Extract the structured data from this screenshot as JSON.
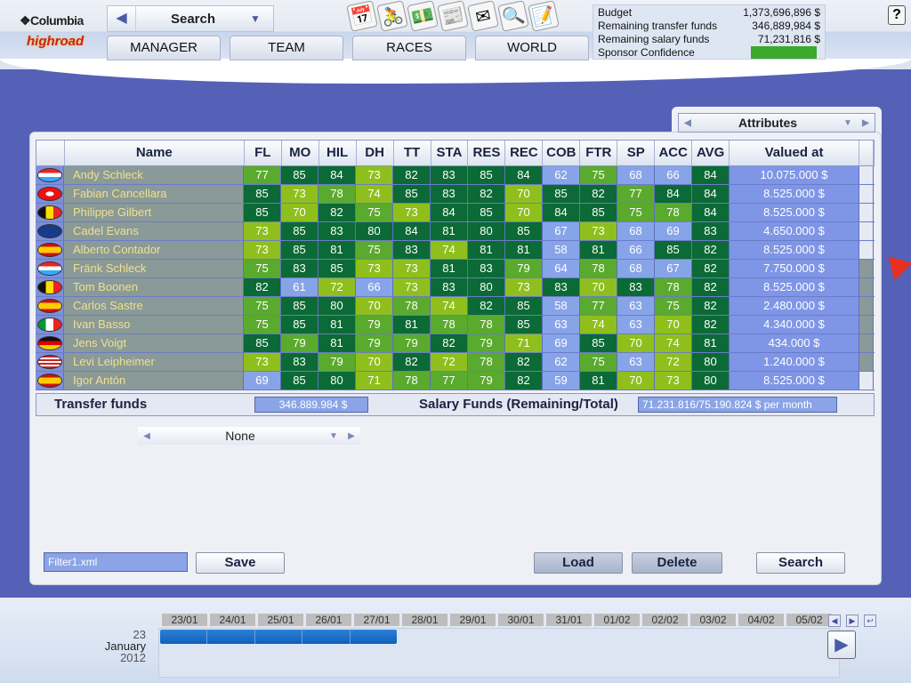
{
  "brand": {
    "logo_top": "❖Columbia",
    "logo_bottom": "highroad"
  },
  "search_select": {
    "value": "Search"
  },
  "tabs": [
    "MANAGER",
    "TEAM",
    "RACES",
    "WORLD"
  ],
  "toolbar_icons": [
    "calendar-icon",
    "rider-icon",
    "money-icon",
    "newspaper-icon",
    "mail-icon",
    "magnifier-icon",
    "notepad-icon"
  ],
  "finance": {
    "budget_label": "Budget",
    "budget": "1,373,696,896 $",
    "transfer_label": "Remaining transfer funds",
    "transfer": "346,889,984 $",
    "salary_label": "Remaining salary funds",
    "salary": "71,231,816 $",
    "sponsor_label": "Sponsor Confidence",
    "sponsor_color": "#3aaa2c"
  },
  "help": "?",
  "attributes_select": "Attributes",
  "table": {
    "columns": [
      "Name",
      "FL",
      "MO",
      "HIL",
      "DH",
      "TT",
      "STA",
      "RES",
      "REC",
      "COB",
      "FTR",
      "SP",
      "ACC",
      "AVG",
      "Valued at"
    ],
    "rows": [
      {
        "flag": "LUX",
        "name": "Andy Schleck",
        "stats": [
          77,
          85,
          84,
          73,
          82,
          83,
          85,
          84,
          62,
          75,
          68,
          66,
          84
        ],
        "value": "10.075.000 $"
      },
      {
        "flag": "SUI",
        "name": "Fabian Cancellara",
        "stats": [
          85,
          73,
          78,
          74,
          85,
          83,
          82,
          70,
          85,
          82,
          77,
          84,
          84
        ],
        "value": "8.525.000 $"
      },
      {
        "flag": "BEL",
        "name": "Philippe Gilbert",
        "stats": [
          85,
          70,
          82,
          75,
          73,
          84,
          85,
          70,
          84,
          85,
          75,
          78,
          84
        ],
        "value": "8.525.000 $"
      },
      {
        "flag": "AUS",
        "name": "Cadel Evans",
        "stats": [
          73,
          85,
          83,
          80,
          84,
          81,
          80,
          85,
          67,
          73,
          68,
          69,
          83
        ],
        "value": "4.650.000 $"
      },
      {
        "flag": "ESP",
        "name": "Alberto Contador",
        "stats": [
          73,
          85,
          81,
          75,
          83,
          74,
          81,
          81,
          58,
          81,
          66,
          85,
          82
        ],
        "value": "8.525.000 $"
      },
      {
        "flag": "LUX",
        "name": "Fränk Schleck",
        "stats": [
          75,
          83,
          85,
          73,
          73,
          81,
          83,
          79,
          64,
          78,
          68,
          67,
          82
        ],
        "value": "7.750.000 $"
      },
      {
        "flag": "BEL",
        "name": "Tom Boonen",
        "stats": [
          82,
          61,
          72,
          66,
          73,
          83,
          80,
          73,
          83,
          70,
          83,
          78,
          82
        ],
        "value": "8.525.000 $"
      },
      {
        "flag": "ESP",
        "name": "Carlos Sastre",
        "stats": [
          75,
          85,
          80,
          70,
          78,
          74,
          82,
          85,
          58,
          77,
          63,
          75,
          82
        ],
        "value": "2.480.000 $"
      },
      {
        "flag": "ITA",
        "name": "Ivan Basso",
        "stats": [
          75,
          85,
          81,
          79,
          81,
          78,
          78,
          85,
          63,
          74,
          63,
          70,
          82
        ],
        "value": "4.340.000 $"
      },
      {
        "flag": "GER",
        "name": "Jens Voigt",
        "stats": [
          85,
          79,
          81,
          79,
          79,
          82,
          79,
          71,
          69,
          85,
          70,
          74,
          81
        ],
        "value": "434.000 $"
      },
      {
        "flag": "USA",
        "name": "Levi Leipheimer",
        "stats": [
          73,
          83,
          79,
          70,
          82,
          72,
          78,
          82,
          62,
          75,
          63,
          72,
          80
        ],
        "value": "1.240.000 $"
      },
      {
        "flag": "ESP",
        "name": "Igor Antón",
        "stats": [
          69,
          85,
          80,
          71,
          78,
          77,
          79,
          82,
          59,
          81,
          70,
          73,
          80
        ],
        "value": "8.525.000 $"
      }
    ]
  },
  "stat_colors": {
    "80_plus": "#0b6a35",
    "75_79": "#5aaa2e",
    "70_74": "#8fbf1c",
    "below_70": "#88a4e8"
  },
  "footer": {
    "transfer_label": "Transfer funds",
    "transfer_value": "346.889.984 $",
    "salary_label": "Salary Funds (Remaining/Total)",
    "salary_value": "71.231.816/75.190.824 $  per month"
  },
  "filter_select": "None",
  "filter_file": "Filter1.xml",
  "buttons": {
    "save": "Save",
    "load": "Load",
    "delete": "Delete",
    "search": "Search"
  },
  "timeline": {
    "dates": [
      "23/01",
      "24/01",
      "25/01",
      "26/01",
      "27/01",
      "28/01",
      "29/01",
      "30/01",
      "31/01",
      "01/02",
      "02/02",
      "03/02",
      "04/02",
      "05/02"
    ],
    "day": "23",
    "month": "January",
    "year": "2012"
  }
}
